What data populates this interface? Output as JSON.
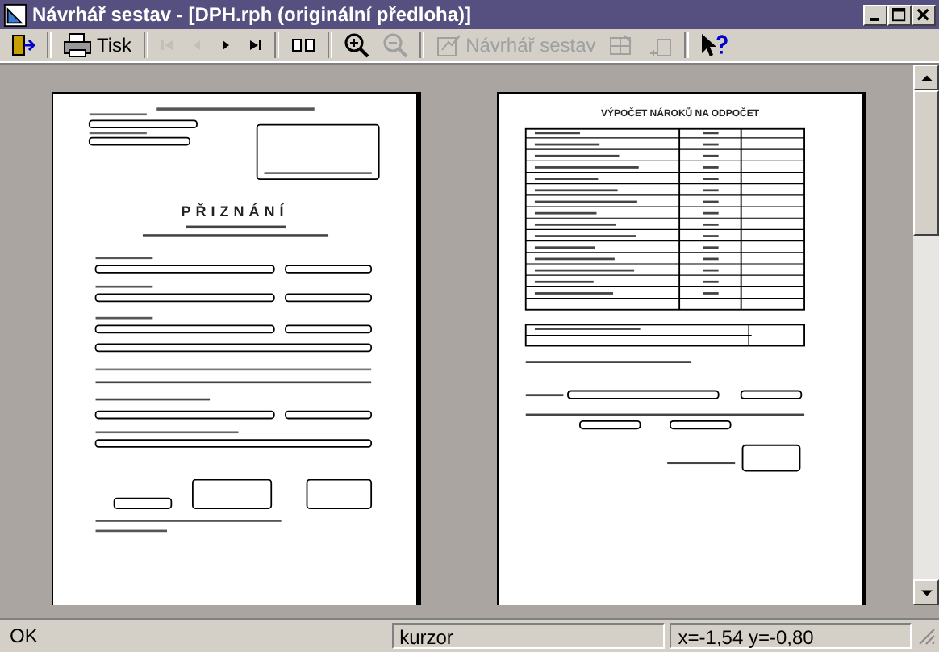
{
  "window": {
    "title": "Návrhář sestav - [DPH.rph (originální předloha)]"
  },
  "toolbar": [
    {
      "kind": "exit",
      "disabled": false
    },
    {
      "kind": "sep"
    },
    {
      "kind": "print",
      "label": "Tisk",
      "disabled": false
    },
    {
      "kind": "sep"
    },
    {
      "kind": "first",
      "disabled": true
    },
    {
      "kind": "prev",
      "disabled": true
    },
    {
      "kind": "next",
      "disabled": false
    },
    {
      "kind": "last",
      "disabled": false
    },
    {
      "kind": "sep"
    },
    {
      "kind": "twopage",
      "disabled": false
    },
    {
      "kind": "sep"
    },
    {
      "kind": "zoomin",
      "disabled": false
    },
    {
      "kind": "zoomout",
      "disabled": true
    },
    {
      "kind": "sep"
    },
    {
      "kind": "design",
      "label": "Návrhář sestav",
      "disabled": true
    },
    {
      "kind": "grid",
      "disabled": true
    },
    {
      "kind": "paste",
      "disabled": true
    },
    {
      "kind": "sep"
    },
    {
      "kind": "help",
      "disabled": false
    }
  ],
  "pages": [
    {
      "kind": "form",
      "heading": "PŘIZNÁNÍ"
    },
    {
      "kind": "table",
      "heading": "VÝPOČET NÁROKŮ NA ODPOČET"
    }
  ],
  "status_bar": {
    "message": "OK",
    "mode": "kurzor",
    "coords": "x=-1,54   y=-0,80"
  }
}
